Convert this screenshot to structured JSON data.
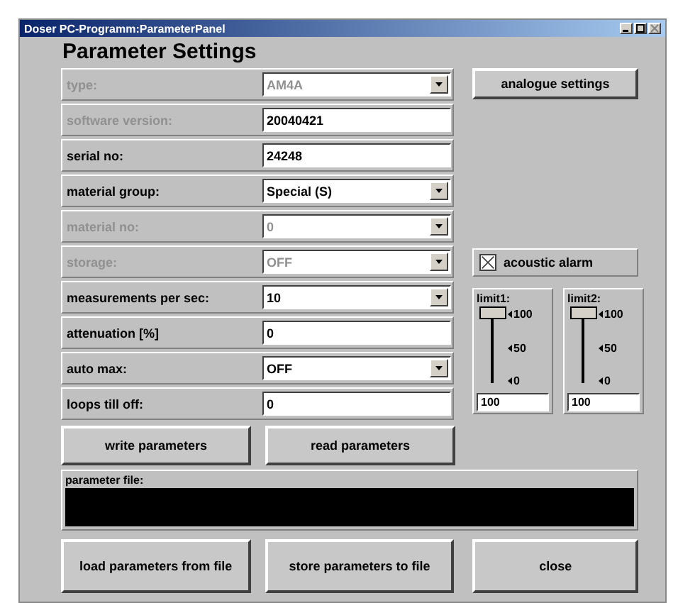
{
  "window": {
    "title": "Doser PC-Programm:ParameterPanel"
  },
  "heading": "Parameter Settings",
  "parameters": [
    {
      "label": "type:",
      "kind": "combo",
      "value": "AM4A",
      "disabled": true
    },
    {
      "label": "software version:",
      "kind": "text",
      "value": "20040421",
      "disabled": true
    },
    {
      "label": "serial no:",
      "kind": "text",
      "value": "24248",
      "disabled": false
    },
    {
      "label": "material group:",
      "kind": "combo",
      "value": "Special (S)",
      "disabled": false
    },
    {
      "label": "material no:",
      "kind": "combo",
      "value": "0",
      "disabled": true
    },
    {
      "label": "storage:",
      "kind": "combo",
      "value": "OFF",
      "disabled": true
    },
    {
      "label": "measurements per sec:",
      "kind": "combo",
      "value": "10",
      "disabled": false
    },
    {
      "label": "attenuation [%]",
      "kind": "text",
      "value": "0",
      "disabled": false
    },
    {
      "label": "auto max:",
      "kind": "combo",
      "value": "OFF",
      "disabled": false
    },
    {
      "label": "loops till off:",
      "kind": "text",
      "value": "0",
      "disabled": false
    }
  ],
  "analogue_button": "analogue settings",
  "acoustic_alarm": {
    "label": "acoustic alarm",
    "checked": true
  },
  "limits": [
    {
      "label": "limit1:",
      "level": 1,
      "ticks": [
        "100",
        "50",
        "0"
      ],
      "value": "100"
    },
    {
      "label": "limit2:",
      "level": 1,
      "ticks": [
        "100",
        "50",
        "0"
      ],
      "value": "100"
    }
  ],
  "action_buttons": [
    "write parameters",
    "read parameters"
  ],
  "parameter_file": {
    "label": "parameter file:"
  },
  "bottom_buttons": [
    "load parameters from file",
    "store parameters to file",
    "close"
  ]
}
